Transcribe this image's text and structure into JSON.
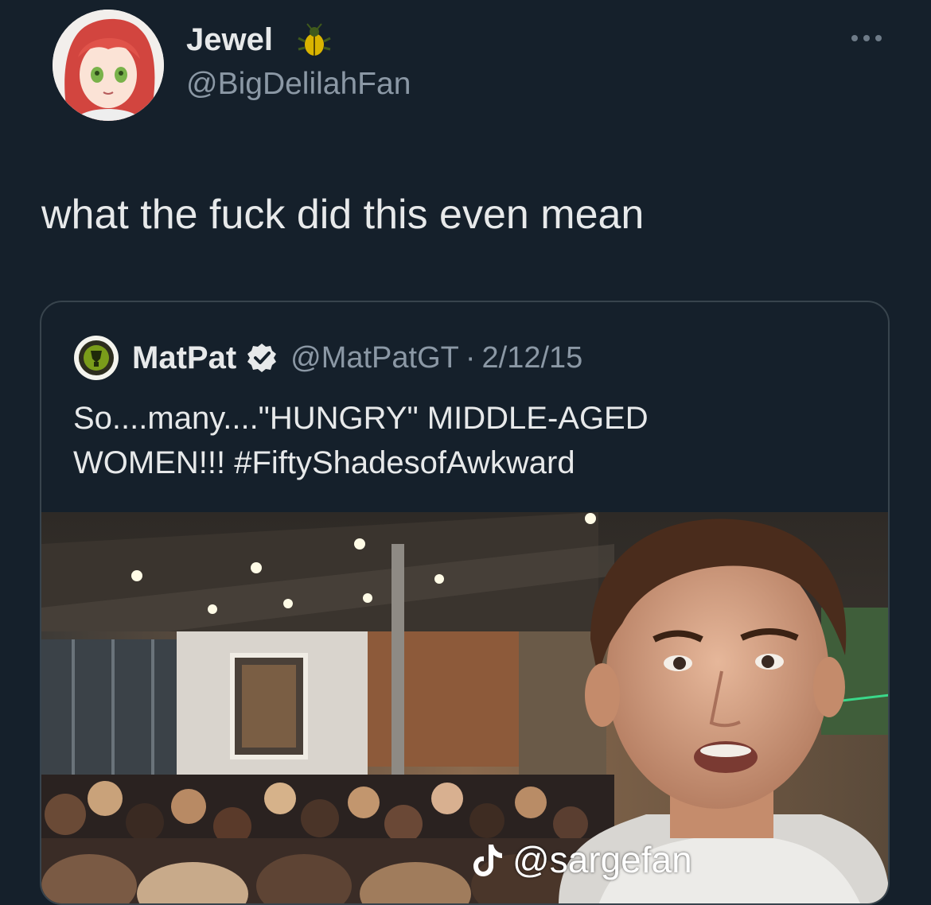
{
  "author": {
    "display_name": "Jewel",
    "handle": "@BigDelilahFan",
    "badge_icon": "bug-emoji-icon",
    "avatar": "anime-girl-red-hair-avatar"
  },
  "tweet": {
    "text": "what the fuck did this even mean"
  },
  "quoted_tweet": {
    "display_name": "MatPat",
    "verified": true,
    "handle": "@MatPatGT",
    "separator": "·",
    "date": "2/12/15",
    "text_line1": "So....many....\"HUNGRY\" MIDDLE-AGED",
    "text_line2": "WOMEN!!! #FiftyShadesofAwkward",
    "media": "selfie-in-crowded-movie-theater-lobby"
  },
  "watermark": {
    "icon": "tiktok-icon",
    "text": "@sargefan"
  },
  "colors": {
    "background": "#15202b",
    "primary_text": "#e7e9ea",
    "secondary_text": "#8b98a5",
    "border": "#38444d",
    "verified": "#e7e9ea"
  }
}
